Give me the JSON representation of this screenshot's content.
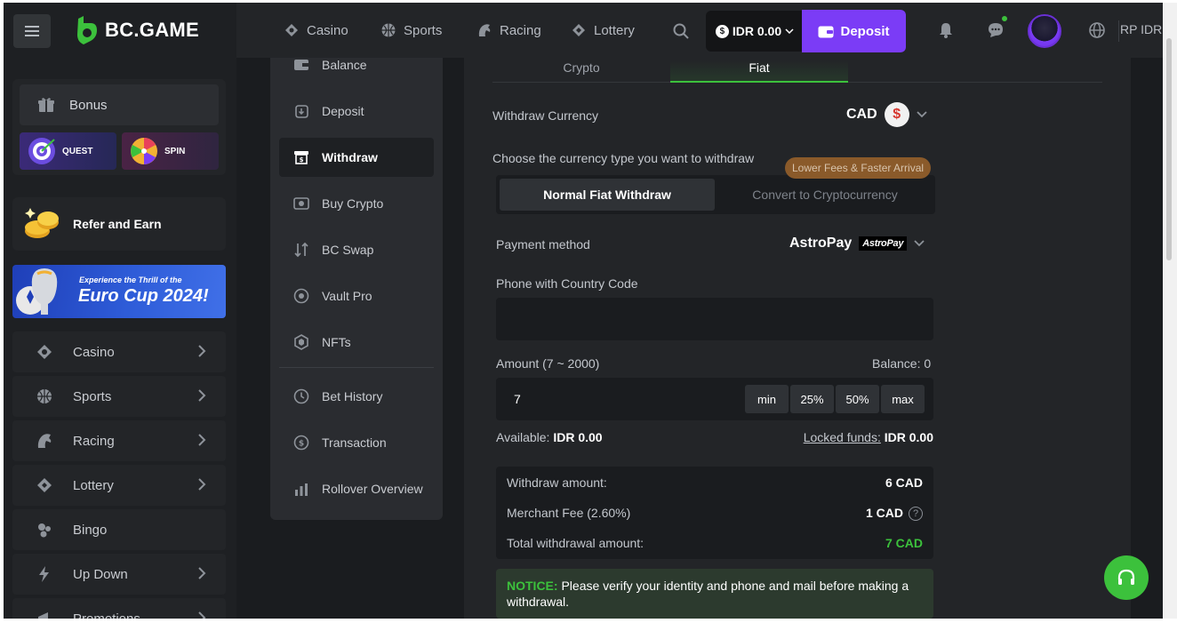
{
  "brand": {
    "name": "BC.GAME",
    "accent": "#3cc13c",
    "purple": "#7b3cf6"
  },
  "header": {
    "nav": [
      {
        "label": "Casino",
        "icon": "casino-icon"
      },
      {
        "label": "Sports",
        "icon": "sports-icon"
      },
      {
        "label": "Racing",
        "icon": "racing-icon"
      },
      {
        "label": "Lottery",
        "icon": "lottery-icon"
      }
    ],
    "balance": "IDR 0.00",
    "deposit_label": "Deposit",
    "lang": "RP IDR"
  },
  "sidebar": {
    "bonus_label": "Bonus",
    "quest_label": "QUEST",
    "spin_label": "SPIN",
    "refer_label": "Refer and Earn",
    "banner_small": "Experience the Thrill of the",
    "banner_big": "Euro Cup 2024!",
    "items": [
      {
        "label": "Casino",
        "icon": "casino-icon",
        "chevron": true
      },
      {
        "label": "Sports",
        "icon": "sports-icon",
        "chevron": true
      },
      {
        "label": "Racing",
        "icon": "racing-icon",
        "chevron": true
      },
      {
        "label": "Lottery",
        "icon": "lottery-icon",
        "chevron": true
      },
      {
        "label": "Bingo",
        "icon": "bingo-icon",
        "chevron": false
      },
      {
        "label": "Up Down",
        "icon": "updown-icon",
        "chevron": true
      },
      {
        "label": "Promotions",
        "icon": "promotions-icon",
        "chevron": true
      }
    ]
  },
  "account_menu": {
    "items": [
      {
        "label": "Balance",
        "icon": "wallet-icon"
      },
      {
        "label": "Deposit",
        "icon": "deposit-icon"
      },
      {
        "label": "Withdraw",
        "icon": "withdraw-icon",
        "active": true
      },
      {
        "label": "Buy Crypto",
        "icon": "buy-crypto-icon"
      },
      {
        "label": "BC Swap",
        "icon": "swap-icon"
      },
      {
        "label": "Vault Pro",
        "icon": "vault-icon"
      },
      {
        "label": "NFTs",
        "icon": "nft-icon"
      },
      {
        "label": "Bet History",
        "icon": "clock-icon"
      },
      {
        "label": "Transaction",
        "icon": "transaction-icon"
      },
      {
        "label": "Rollover Overview",
        "icon": "rollover-icon"
      }
    ]
  },
  "withdraw": {
    "tabs": [
      "Crypto",
      "Fiat"
    ],
    "active_tab": "Fiat",
    "currency_label": "Withdraw Currency",
    "currency": "CAD",
    "currency_symbol": "$",
    "type_label": "Choose the currency type you want to withdraw",
    "type_options": [
      "Normal Fiat Withdraw",
      "Convert to Cryptocurrency"
    ],
    "promo_pill": "Lower Fees & Faster Arrival",
    "payment_label": "Payment method",
    "payment_method": "AstroPay",
    "payment_badge": "AstroPay",
    "phone_label": "Phone with Country Code",
    "phone_value": "",
    "amount_label": "Amount (7 ~ 2000)",
    "balance_label": "Balance: 0",
    "amount_value": "7",
    "quick": [
      "min",
      "25%",
      "50%",
      "max"
    ],
    "available_label": "Available:",
    "available_value": "IDR 0.00",
    "locked_label": "Locked funds:",
    "locked_value": "IDR 0.00",
    "summary": [
      {
        "label": "Withdraw amount:",
        "value": "6 CAD"
      },
      {
        "label": "Merchant Fee (2.60%)",
        "value": "1 CAD"
      },
      {
        "label": "Total withdrawal amount:",
        "value": "7 CAD"
      }
    ],
    "notice_title": "NOTICE:",
    "notice_text": "Please verify your identity and phone and mail before making a withdrawal."
  }
}
